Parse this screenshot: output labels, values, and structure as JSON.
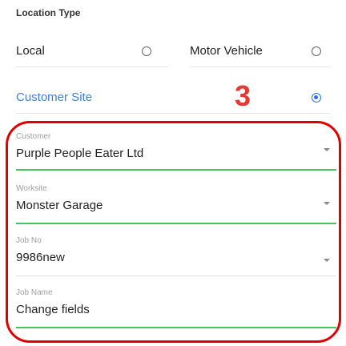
{
  "location_type": {
    "title": "Location Type",
    "options": [
      {
        "label": "Local",
        "selected": false
      },
      {
        "label": "Motor Vehicle",
        "selected": false
      },
      {
        "label": "Customer Site",
        "selected": true
      }
    ]
  },
  "annotation": {
    "step_number": "3",
    "color": "#e53935",
    "outline_color": "#e00000"
  },
  "fields": [
    {
      "label": "Customer",
      "value": "Purple People Eater Ltd",
      "dropdown": true
    },
    {
      "label": "Worksite",
      "value": "Monster Garage",
      "dropdown": true
    },
    {
      "label": "Job No",
      "value": "9986new",
      "dropdown": true
    },
    {
      "label": "Job Name",
      "value": "Change fields",
      "dropdown": false
    }
  ],
  "colors": {
    "accent_blue": "#2f6fdc",
    "active_underline": "#43c65a"
  }
}
